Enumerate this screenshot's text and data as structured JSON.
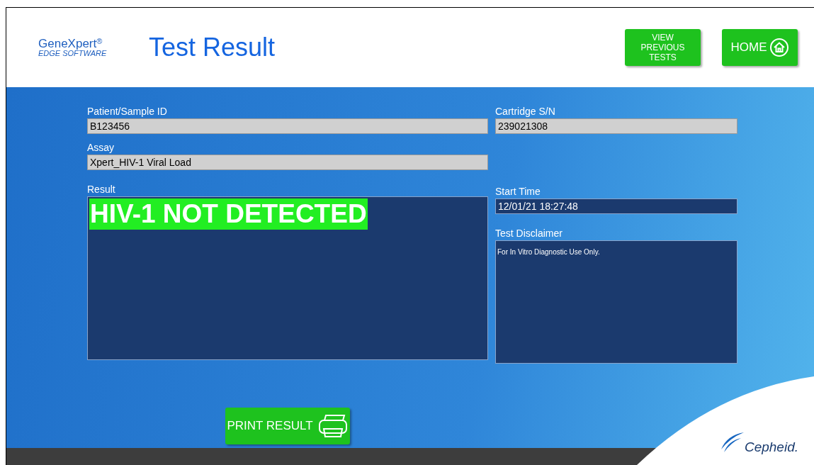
{
  "logo": {
    "name": "GeneXpert",
    "mark": "®",
    "subtitle": "EDGE SOFTWARE"
  },
  "title": "Test Result",
  "header_buttons": [
    {
      "kind": "text",
      "label": "VIEW PREVIOUS TESTS"
    },
    {
      "kind": "home",
      "label": "HOME"
    }
  ],
  "patient_sample_id": {
    "label": "Patient/Sample ID",
    "value": "B123456"
  },
  "cartridge_sn": {
    "label": "Cartridge S/N",
    "value": "239021308"
  },
  "assay": {
    "label": "Assay",
    "value": "Xpert_HIV-1 Viral Load"
  },
  "result": {
    "label": "Result",
    "value": "HIV-1 NOT DETECTED"
  },
  "start_time": {
    "label": "Start Time",
    "value": "12/01/21 18:27:48"
  },
  "test_disclaimer": {
    "label": "Test Disclaimer",
    "value": "For In Vitro Diagnostic Use Only."
  },
  "print_button": {
    "label": "PRINT RESULT"
  },
  "brand": "Cepheid."
}
